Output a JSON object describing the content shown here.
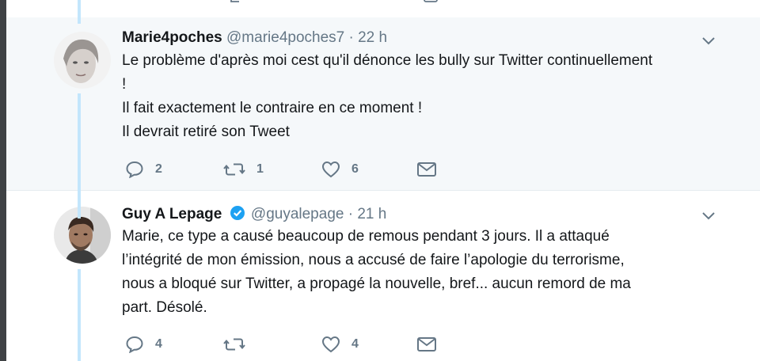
{
  "tweets": [
    {
      "name": "Marie4poches",
      "handle": "@marie4poches7",
      "dot": "·",
      "time": "22 h",
      "lines": [
        "Le problème d'après moi cest qu'il dénonce les bully sur Twitter continuellement",
        "!",
        "Il fait exactement le contraire en ce moment !",
        "Il devrait retiré son Tweet"
      ],
      "actions": {
        "reply_count": "2",
        "retweet_count": "1",
        "like_count": "6"
      },
      "highlight": true
    },
    {
      "name": "Guy A Lepage",
      "verified": true,
      "handle": "@guyalepage",
      "dot": "·",
      "time": "21 h",
      "lines": [
        "Marie, ce type a causé beaucoup de remous pendant 3 jours. Il a attaqué",
        "l’intégrité de mon émission, nous a accusé de faire l’apologie du terrorisme,",
        "nous a bloqué sur Twitter, a propagé la nouvelle, bref... aucun remord de ma",
        "part. Désolé."
      ],
      "actions": {
        "reply_count": "4",
        "retweet_count": "",
        "like_count": "4"
      },
      "highlight": false
    }
  ],
  "colors": {
    "accent": "#1da1f2",
    "thread_line": "#c3e6fc",
    "muted": "#657786",
    "highlight_bg": "#f5f8fa"
  },
  "icons": [
    "reply-icon",
    "retweet-icon",
    "like-icon",
    "message-icon",
    "verified-icon",
    "chevron-down-icon"
  ]
}
